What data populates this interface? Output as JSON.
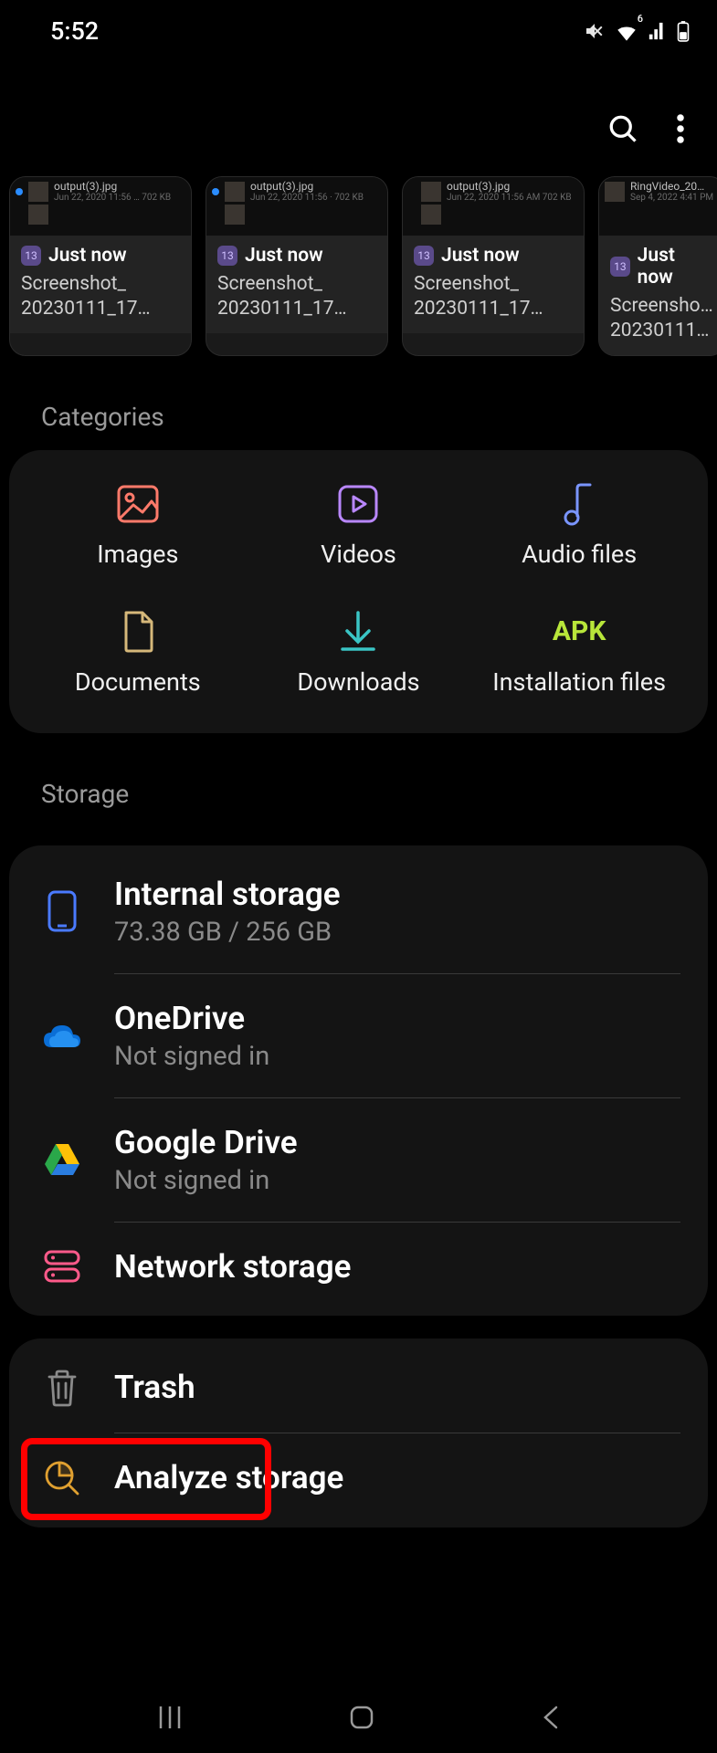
{
  "status": {
    "time": "5:52",
    "wifi_badge": "6"
  },
  "recents": [
    {
      "time": "Just now",
      "line1": "Screenshot_",
      "line2": "20230111_17…",
      "thumbName": "output(3).jpg",
      "thumbMeta": "Jun 22, 2020 11:56 … 702 KB"
    },
    {
      "time": "Just now",
      "line1": "Screenshot_",
      "line2": "20230111_17…",
      "thumbName": "output(3).jpg",
      "thumbMeta": "Jun 22, 2020 11:56 · 702 KB"
    },
    {
      "time": "Just now",
      "line1": "Screenshot_",
      "line2": "20230111_17…",
      "thumbName": "output(3).jpg",
      "thumbMeta": "Jun 22, 2020 11:56 AM   702 KB"
    },
    {
      "time": "Just now",
      "line1": "Screenshot_",
      "line2": "20230111_…",
      "thumbName": "RingVideo_20…",
      "thumbMeta": "Sep 4, 2022 4:41 PM"
    }
  ],
  "sections": {
    "categories": "Categories",
    "storage": "Storage"
  },
  "categories": {
    "images": "Images",
    "videos": "Videos",
    "audio": "Audio files",
    "documents": "Documents",
    "downloads": "Downloads",
    "apk": "Installation files",
    "apk_badge": "APK"
  },
  "storage": {
    "internal": {
      "title": "Internal storage",
      "sub": "73.38 GB / 256 GB"
    },
    "onedrive": {
      "title": "OneDrive",
      "sub": "Not signed in"
    },
    "gdrive": {
      "title": "Google Drive",
      "sub": "Not signed in"
    },
    "network": {
      "title": "Network storage"
    }
  },
  "tools": {
    "trash": "Trash",
    "analyze": "Analyze storage"
  }
}
